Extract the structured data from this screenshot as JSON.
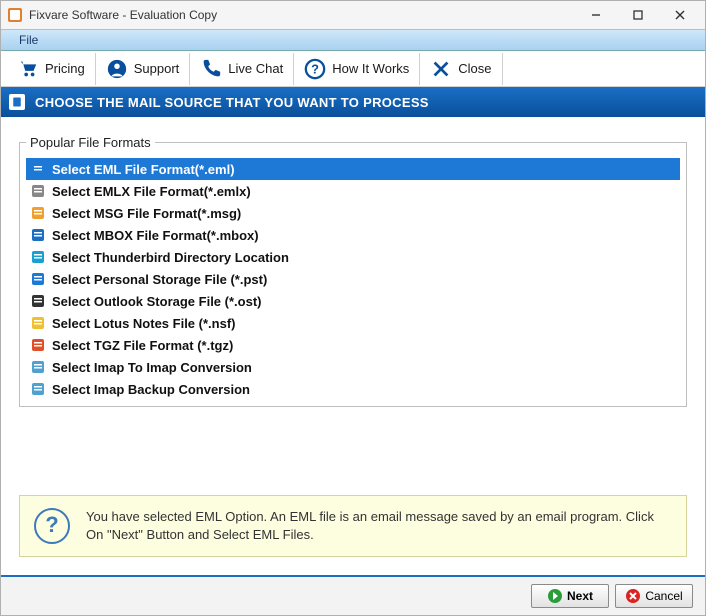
{
  "window": {
    "title": "Fixvare Software - Evaluation Copy"
  },
  "menu": {
    "file": "File"
  },
  "toolbar": {
    "pricing": "Pricing",
    "support": "Support",
    "livechat": "Live Chat",
    "howitworks": "How It Works",
    "close": "Close"
  },
  "banner": {
    "text": "CHOOSE THE MAIL SOURCE THAT YOU WANT TO PROCESS"
  },
  "formats": {
    "legend": "Popular File Formats",
    "items": [
      "Select EML File Format(*.eml)",
      "Select EMLX File Format(*.emlx)",
      "Select MSG File Format(*.msg)",
      "Select MBOX File Format(*.mbox)",
      "Select Thunderbird Directory Location",
      "Select Personal Storage File (*.pst)",
      "Select Outlook Storage File (*.ost)",
      "Select Lotus Notes File (*.nsf)",
      "Select TGZ File Format (*.tgz)",
      "Select Imap To Imap Conversion",
      "Select Imap Backup Conversion"
    ],
    "selected_index": 0
  },
  "hint": {
    "text": "You have selected EML Option. An EML file is an email message saved by an email program. Click On \"Next\" Button and Select EML Files."
  },
  "buttons": {
    "next": "Next",
    "cancel": "Cancel"
  },
  "colors": {
    "accent": "#1a6fc4",
    "selection": "#1e78d6",
    "hint_bg": "#fdfde0"
  }
}
